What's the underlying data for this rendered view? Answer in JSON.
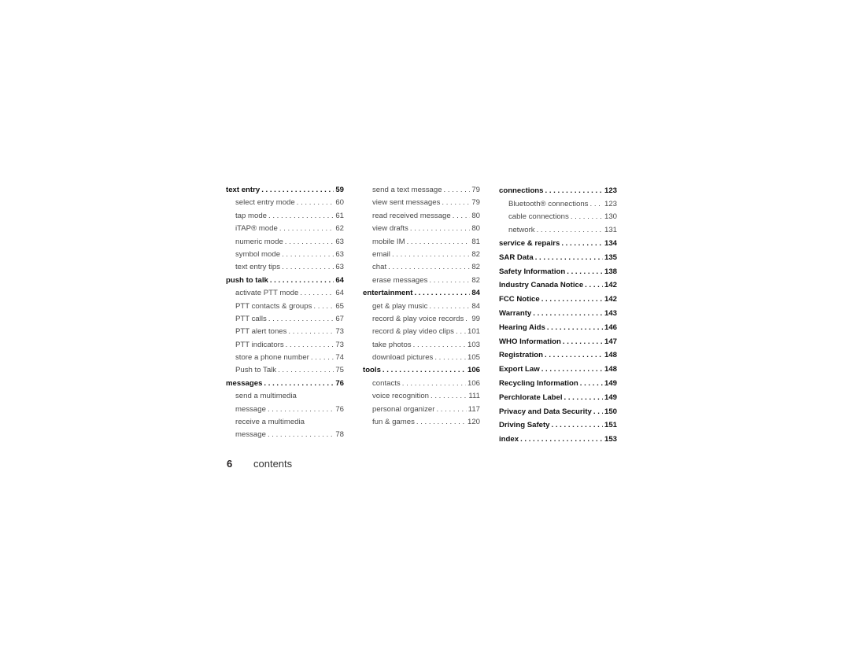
{
  "columns": [
    [
      {
        "label": "text entry",
        "page": "59",
        "level": "main"
      },
      {
        "label": "select entry mode",
        "page": "60",
        "level": "sub"
      },
      {
        "label": "tap mode",
        "page": "61",
        "level": "sub"
      },
      {
        "label": "iTAP® mode",
        "page": "62",
        "level": "sub"
      },
      {
        "label": "numeric mode",
        "page": "63",
        "level": "sub"
      },
      {
        "label": "symbol mode",
        "page": "63",
        "level": "sub"
      },
      {
        "label": "text entry tips",
        "page": "63",
        "level": "sub"
      },
      {
        "label": "push to talk",
        "page": "64",
        "level": "main"
      },
      {
        "label": "activate PTT mode",
        "page": "64",
        "level": "sub"
      },
      {
        "label": "PTT contacts & groups",
        "page": "65",
        "level": "sub"
      },
      {
        "label": "PTT calls",
        "page": "67",
        "level": "sub"
      },
      {
        "label": "PTT alert tones",
        "page": "73",
        "level": "sub"
      },
      {
        "label": "PTT indicators",
        "page": "73",
        "level": "sub"
      },
      {
        "label": "store a phone number",
        "page": "74",
        "level": "sub"
      },
      {
        "label": "Push to Talk",
        "page": "75",
        "level": "sub"
      },
      {
        "label": "messages",
        "page": "76",
        "level": "main"
      },
      {
        "label": "send a multimedia",
        "page": "",
        "level": "sub"
      },
      {
        "label": "message",
        "page": "76",
        "level": "sub"
      },
      {
        "label": "receive a multimedia",
        "page": "",
        "level": "sub"
      },
      {
        "label": "message",
        "page": "78",
        "level": "sub"
      }
    ],
    [
      {
        "label": "send a text message",
        "page": "79",
        "level": "sub"
      },
      {
        "label": "view sent messages",
        "page": "79",
        "level": "sub"
      },
      {
        "label": "read received message",
        "page": "80",
        "level": "sub"
      },
      {
        "label": "view drafts",
        "page": "80",
        "level": "sub"
      },
      {
        "label": "mobile IM",
        "page": "81",
        "level": "sub"
      },
      {
        "label": "email",
        "page": "82",
        "level": "sub"
      },
      {
        "label": "chat",
        "page": "82",
        "level": "sub"
      },
      {
        "label": "erase messages",
        "page": "82",
        "level": "sub"
      },
      {
        "label": "entertainment",
        "page": "84",
        "level": "main"
      },
      {
        "label": "get & play music",
        "page": "84",
        "level": "sub"
      },
      {
        "label": "record & play voice records",
        "page": "99",
        "level": "sub"
      },
      {
        "label": "record & play video clips",
        "page": "101",
        "level": "sub"
      },
      {
        "label": "take photos",
        "page": "103",
        "level": "sub"
      },
      {
        "label": "download pictures",
        "page": "105",
        "level": "sub"
      },
      {
        "label": "tools",
        "page": "106",
        "level": "main"
      },
      {
        "label": "contacts",
        "page": "106",
        "level": "sub"
      },
      {
        "label": "voice recognition",
        "page": "111",
        "level": "sub"
      },
      {
        "label": "personal organizer",
        "page": "117",
        "level": "sub"
      },
      {
        "label": "fun & games",
        "page": "120",
        "level": "sub"
      }
    ],
    [
      {
        "label": "connections",
        "page": "123",
        "level": "main"
      },
      {
        "label": "Bluetooth® connections",
        "page": "123",
        "level": "sub"
      },
      {
        "label": "cable connections",
        "page": "130",
        "level": "sub"
      },
      {
        "label": "network",
        "page": "131",
        "level": "sub"
      },
      {
        "label": "service & repairs",
        "page": "134",
        "level": "main"
      },
      {
        "label": "SAR Data",
        "page": "135",
        "level": "main"
      },
      {
        "label": "Safety Information",
        "page": "138",
        "level": "main"
      },
      {
        "label": "Industry Canada Notice",
        "page": "142",
        "level": "main"
      },
      {
        "label": "FCC Notice",
        "page": "142",
        "level": "main"
      },
      {
        "label": "Warranty",
        "page": "143",
        "level": "main"
      },
      {
        "label": "Hearing Aids",
        "page": "146",
        "level": "main"
      },
      {
        "label": "WHO Information",
        "page": "147",
        "level": "main"
      },
      {
        "label": "Registration",
        "page": "148",
        "level": "main"
      },
      {
        "label": "Export Law",
        "page": "148",
        "level": "main"
      },
      {
        "label": "Recycling Information",
        "page": "149",
        "level": "main"
      },
      {
        "label": "Perchlorate Label",
        "page": "149",
        "level": "main"
      },
      {
        "label": "Privacy and Data Security",
        "page": "150",
        "level": "main"
      },
      {
        "label": "Driving Safety",
        "page": "151",
        "level": "main"
      },
      {
        "label": "index",
        "page": "153",
        "level": "main"
      }
    ]
  ],
  "footer": {
    "page_number": "6",
    "section": "contents"
  }
}
